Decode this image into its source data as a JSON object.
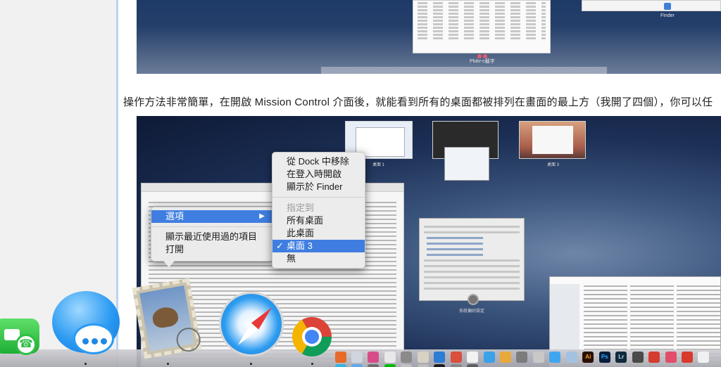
{
  "top_screenshot": {
    "window_label": "Plokr-c截字",
    "finder_label": "Finder"
  },
  "caption": "操作方法非常簡單，在開啟 Mission Control 介面後，就能看到所有的桌面都被排列在畫面的最上方（我開了四個），你可以任",
  "mission_control": {
    "desktops": [
      {
        "label": "桌面 1"
      },
      {
        "label": ""
      },
      {
        "label": "桌面 3"
      }
    ],
    "prefs_label": "系統偏好設定"
  },
  "option_menu": {
    "items": [
      {
        "label": "選項",
        "highlighted": true,
        "submenu_arrow": "▶"
      },
      {
        "label": "顯示最近使用過的項目"
      },
      {
        "label": "打開"
      }
    ]
  },
  "submenu": {
    "items": [
      {
        "label": "從 Dock 中移除"
      },
      {
        "label": "在登入時開啟"
      },
      {
        "label": "顯示於 Finder"
      },
      {
        "label": "指定到",
        "disabled": true
      },
      {
        "label": "所有桌面"
      },
      {
        "label": "此桌面"
      },
      {
        "label": "桌面 3",
        "checked": true,
        "highlighted": true,
        "checkmark": "✓"
      },
      {
        "label": "無"
      }
    ]
  },
  "dock": {
    "icons": [
      "facetime-icon",
      "messages-icon",
      "mail-icon",
      "safari-icon",
      "chrome-icon"
    ],
    "mini_labels": [
      "Ai",
      "Ps",
      "Lr"
    ]
  },
  "colors": {
    "highlight": "#3f7ee0",
    "sidebar_divider": "#b9d3f2"
  }
}
